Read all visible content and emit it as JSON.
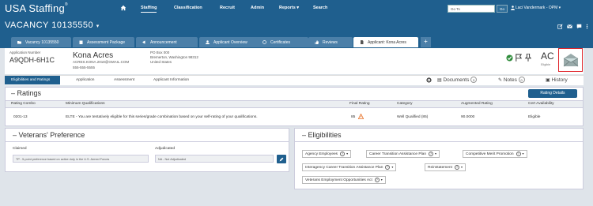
{
  "app": {
    "logo": "USA Staffing",
    "logo_mark": "®"
  },
  "nav": {
    "items": [
      "Staffing",
      "Classification",
      "Recruit",
      "Admin",
      "Reports ▾",
      "Search"
    ],
    "goto_placeholder": "Go To",
    "goto_button": "Go",
    "user": "Laci Vandermark - OPM ▾"
  },
  "vacancy": {
    "title": "VACANCY 10135550",
    "caret": "▾"
  },
  "tabs": [
    "Vacancy 10135550",
    "Assessment Package",
    "Announcement",
    "Applicant Overview",
    "Certificates",
    "Reviews",
    "Applicant: Kona Acres"
  ],
  "tab_add": "+",
  "applicant": {
    "number_label": "Application Number",
    "number": "A9QDH-6H1C",
    "name": "Kona Acres",
    "email": "ACRES.KONA.2018@GMAIL.COM",
    "phone": "555-555-5555",
    "address": [
      "PO Box 000",
      "Bremerton, Washington   98312",
      "United States"
    ],
    "code": "AC",
    "eligibility_note": "Eligible"
  },
  "workflow": {
    "steps": [
      "Eligibilities and Ratings",
      "Application",
      "Assessment",
      "Applicant Information"
    ],
    "documents_label": "Documents",
    "documents_count": "3",
    "notes_label": "Notes",
    "notes_count": "0",
    "history_label": "History"
  },
  "ratings": {
    "title": "Ratings",
    "details_button": "Rating Details",
    "columns": [
      "Rating Combo",
      "Minimum Qualifications",
      "Final Rating",
      "Category",
      "Augmented Rating",
      "Cert Availability"
    ],
    "rows": [
      {
        "combo": "0201-13",
        "min_qual": "ELTE - You are tentatively eligible for this series/grade combination based on your self-rating of your qualifications.",
        "final": "85",
        "category": "Well Qualified (85)",
        "augmented": "90.0000",
        "cert": "Eligible"
      }
    ]
  },
  "veterans": {
    "title": "Veterans' Preference",
    "claimed_label": "Claimed",
    "claimed_value": "TP - 5-point preference based on active duty in the U.S. Armed Forces",
    "adjudicated_label": "Adjudicated",
    "adjudicated_value": "NA - Not Adjudicated"
  },
  "eligibilities": {
    "title": "Eligibilities",
    "items": [
      "Agency Employees",
      "Career Transition Assistance Plan",
      "Competitive Merit Promotion",
      "Interagency Career Transition Assistance Plan",
      "Reinstatement",
      "Veterans Employment Opportunities Act"
    ]
  },
  "colors": {
    "primary": "#1f5f8e",
    "tab": "#4b7fa8",
    "warning": "#e8762d",
    "highlight": "#e0262c"
  }
}
